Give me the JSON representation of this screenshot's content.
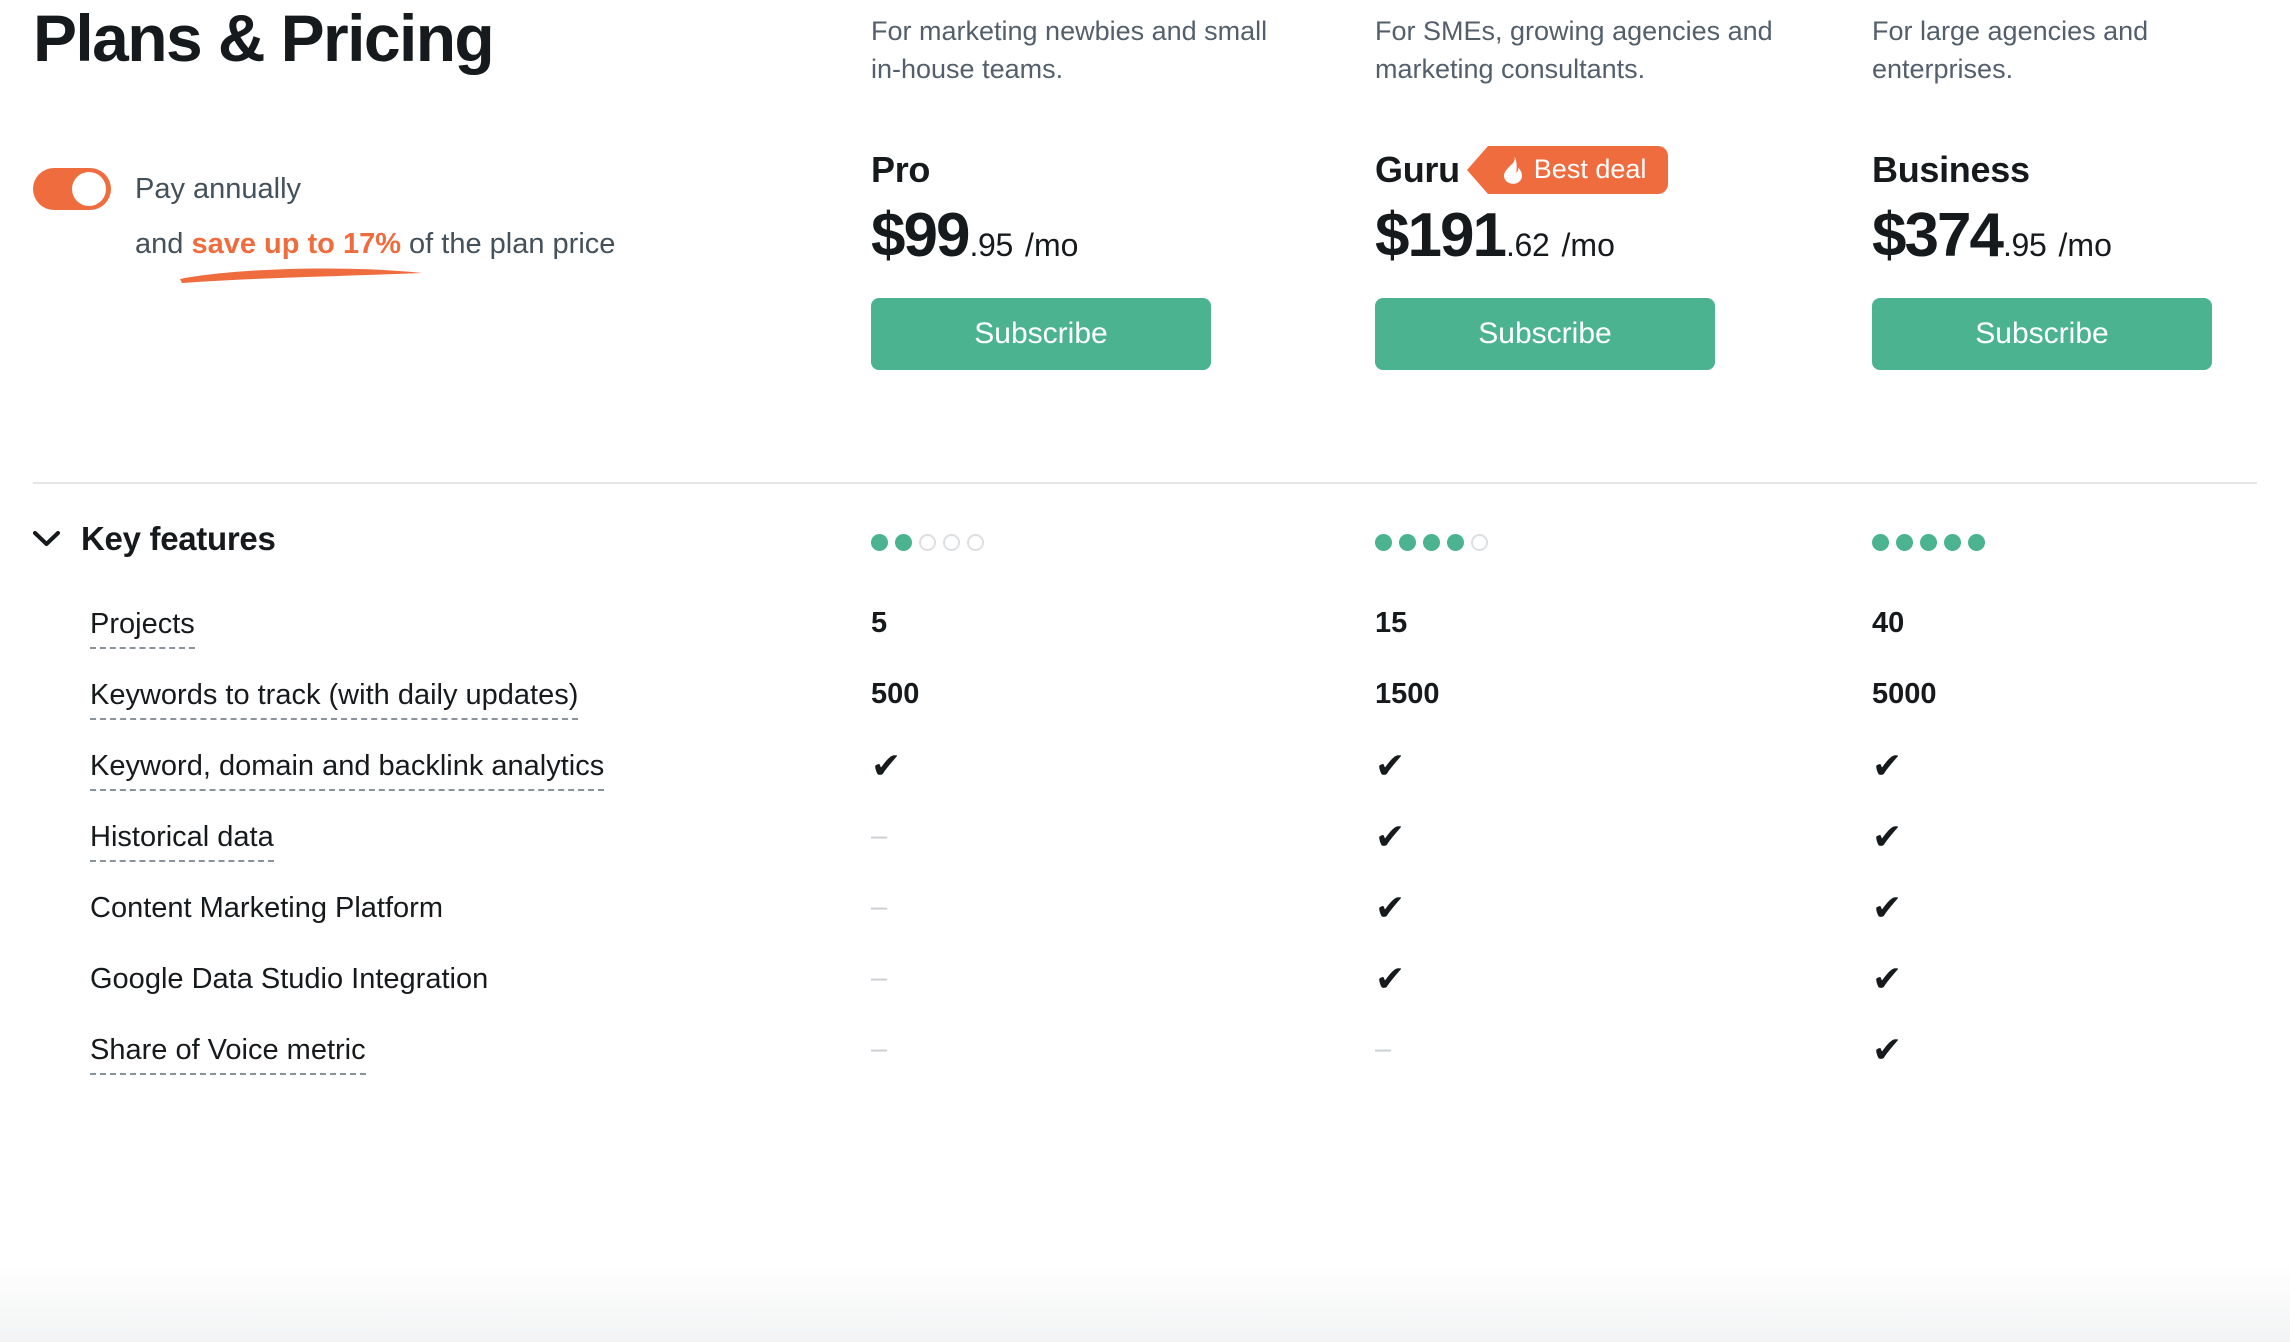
{
  "header": {
    "title": "Plans & Pricing"
  },
  "billing_toggle": {
    "state": "on",
    "label": "Pay annually",
    "sub_prefix": "and ",
    "sub_highlight": "save up to 17%",
    "sub_suffix": " of the plan price"
  },
  "colors": {
    "accent_orange": "#EF6C3F",
    "accent_green": "#4CB391",
    "text_dark": "#171A1C",
    "text_muted": "#545F6B",
    "divider": "#E4E6E8",
    "dot_empty_border": "#DDE0E3",
    "dash_gray": "#C9CED4"
  },
  "plans": [
    {
      "id": "pro",
      "description": "For marketing newbies and small in-house teams.",
      "name": "Pro",
      "badge": null,
      "price_main": "$99",
      "price_cents": ".95",
      "price_period": "/mo",
      "cta_label": "Subscribe",
      "rating_filled": 2,
      "rating_total": 5
    },
    {
      "id": "guru",
      "description": "For SMEs, growing agencies and marketing consultants.",
      "name": "Guru",
      "badge": {
        "label": "Best deal",
        "icon": "flame-icon"
      },
      "price_main": "$191",
      "price_cents": ".62",
      "price_period": "/mo",
      "cta_label": "Subscribe",
      "rating_filled": 4,
      "rating_total": 5
    },
    {
      "id": "business",
      "description": "For large agencies and enterprises.",
      "name": "Business",
      "badge": null,
      "price_main": "$374",
      "price_cents": ".95",
      "price_period": "/mo",
      "cta_label": "Subscribe",
      "rating_filled": 5,
      "rating_total": 5
    }
  ],
  "features_section": {
    "title": "Key features",
    "expanded": true,
    "chevron": "chevron-down-icon",
    "check_glyph": "✔",
    "dash_glyph": "–",
    "rows": [
      {
        "label": "Projects",
        "tooltip": true,
        "values": [
          "5",
          "15",
          "40"
        ]
      },
      {
        "label": "Keywords to track (with daily updates)",
        "tooltip": true,
        "values": [
          "500",
          "1500",
          "5000"
        ]
      },
      {
        "label": "Keyword, domain and backlink analytics",
        "tooltip": true,
        "values": [
          "check",
          "check",
          "check"
        ]
      },
      {
        "label": "Historical data",
        "tooltip": true,
        "values": [
          "dash",
          "check",
          "check"
        ]
      },
      {
        "label": "Content Marketing Platform",
        "tooltip": false,
        "values": [
          "dash",
          "check",
          "check"
        ]
      },
      {
        "label": "Google Data Studio Integration",
        "tooltip": false,
        "values": [
          "dash",
          "check",
          "check"
        ]
      },
      {
        "label": "Share of Voice metric",
        "tooltip": true,
        "values": [
          "dash",
          "dash",
          "check"
        ]
      }
    ]
  }
}
